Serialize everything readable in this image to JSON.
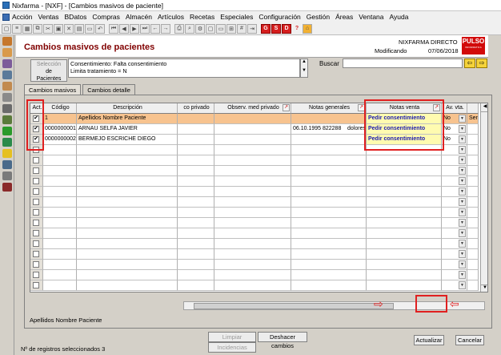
{
  "window": {
    "title": "Nixfarma - [NXF] - [Cambios masivos de paciente]"
  },
  "menu": [
    "Acción",
    "Ventas",
    "BDatos",
    "Compras",
    "Almacén",
    "Artículos",
    "Recetas",
    "Especiales",
    "Configuración",
    "Gestión",
    "Áreas",
    "Ventana",
    "Ayuda"
  ],
  "toolbar": {
    "g": "G",
    "s": "S",
    "d": "D",
    "help": "?"
  },
  "header": {
    "title": "Cambios masivos de pacientes",
    "app": "NIXFARMA DIRECTO",
    "status": "Modificando",
    "date": "07/06/2018",
    "logo": "PULSO",
    "logo_sub": "INFORMATICA"
  },
  "selection": {
    "button_line1": "Selección",
    "button_line2": "de",
    "button_line3": "Pacientes",
    "line1": "Consentimiento: Falta consentimiento",
    "line2": "Limita tratamiento = N"
  },
  "search": {
    "label": "Buscar",
    "value": ""
  },
  "tabs": [
    "Cambios masivos",
    "Cambios detalle"
  ],
  "grid": {
    "headers": [
      "Act.",
      "Código",
      "Descripción",
      "co privado",
      "Observ. med privado",
      "Notas generales",
      "Notas venta",
      "Av. vta."
    ],
    "rows": [
      {
        "act": true,
        "codigo": "1",
        "descripcion": "Apellidos Nombre Paciente",
        "notas_generales": "",
        "notas_venta": "Pedir consentimiento",
        "av": "No",
        "extra": "Ser"
      },
      {
        "act": true,
        "codigo": "0000000001",
        "descripcion": "ARNAU SELFA JAVIER",
        "notas_generales": "06.10.1995 822288",
        "notas_extra": "dolores",
        "notas_venta": "Pedir consentimiento",
        "av": "No",
        "extra": ""
      },
      {
        "act": true,
        "codigo": "0000000002",
        "descripcion": "BERMEJO ESCRICHE DIEGO",
        "notas_generales": "",
        "notas_venta": "Pedir consentimiento",
        "av": "No",
        "extra": ""
      }
    ]
  },
  "bottom_label": "Apellidos Nombre Paciente",
  "footer": {
    "limpiar": "Limpiar",
    "incidencias": "Incidencias",
    "deshacer": "Deshacer cambios",
    "actualizar": "Actualizar",
    "cancelar": "Cancelar"
  },
  "status": "Nº de registros seleccionados 3",
  "colors": {
    "highlight_row": "#f7c38f",
    "accent_red": "#e02020",
    "notas_venta_bg": "#fffbb0",
    "notas_venta_text": "#1a1ab0"
  }
}
